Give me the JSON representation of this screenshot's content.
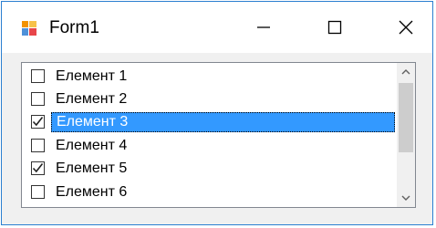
{
  "window": {
    "title": "Form1",
    "icon": "winforms-app-icon",
    "controls": [
      "minimize-icon",
      "maximize-icon",
      "close-icon"
    ]
  },
  "listbox": {
    "items": [
      {
        "label": "Елемент 1",
        "checked": false,
        "selected": false
      },
      {
        "label": "Елемент 2",
        "checked": false,
        "selected": false
      },
      {
        "label": "Елемент 3",
        "checked": true,
        "selected": true
      },
      {
        "label": "Елемент 4",
        "checked": false,
        "selected": false
      },
      {
        "label": "Елемент 5",
        "checked": true,
        "selected": false
      },
      {
        "label": "Елемент 6",
        "checked": false,
        "selected": false
      }
    ]
  },
  "colors": {
    "accent_border": "#2b7fd0",
    "selection": "#3399ff"
  }
}
